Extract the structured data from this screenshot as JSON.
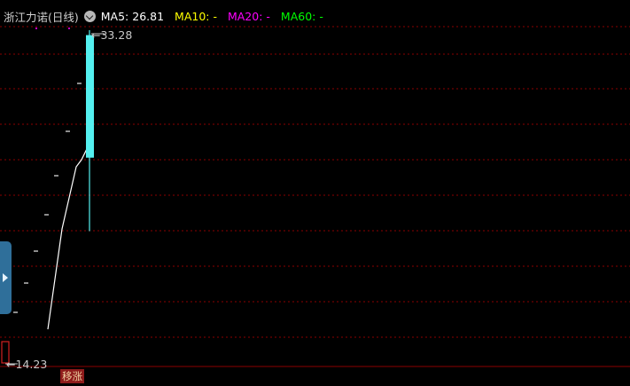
{
  "chart": {
    "title": "浙江力诺(日线)",
    "ma5_label": "MA5: 26.81",
    "ma10_label": "MA10: -",
    "ma20_label": "MA20: -",
    "ma60_label": "MA60: -",
    "high_label": "33.28",
    "low_label": "14.23",
    "badge_label": "移涨"
  },
  "colors": {
    "background": "#000000",
    "grid": "#8b0000",
    "candle": "#54f0f0",
    "ma5": "#ffffff",
    "ma10": "#ffff00",
    "ma20": "#ff00ff",
    "ma60": "#00ff00"
  },
  "chart_data": {
    "type": "candlestick",
    "title": "浙江力诺(日线)",
    "price_range": [
      14.23,
      33.28
    ],
    "candles": [
      {
        "open": 26.0,
        "high": 33.28,
        "low": 21.5,
        "close": 33.0
      }
    ],
    "ma5_line": [
      16.2,
      26.81
    ],
    "ma_values": {
      "MA5": 26.81,
      "MA10": null,
      "MA20": null,
      "MA60": null
    }
  }
}
